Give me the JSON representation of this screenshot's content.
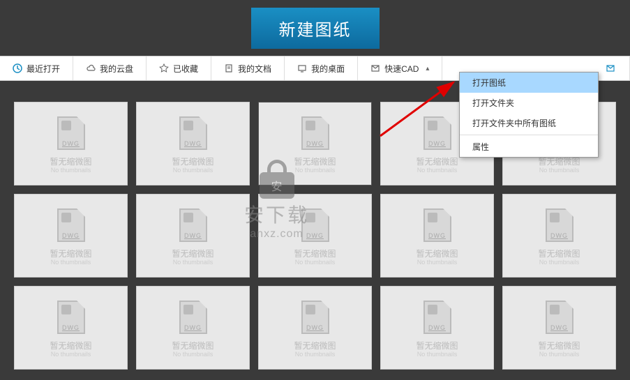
{
  "header": {
    "new_drawing": "新建图纸"
  },
  "tabs": {
    "recent": "最近打开",
    "cloud": "我的云盘",
    "favorites": "已收藏",
    "documents": "我的文档",
    "desktop": "我的桌面",
    "quickcad": "快速CAD"
  },
  "menu": {
    "open_drawing": "打开图纸",
    "open_folder": "打开文件夹",
    "open_all_in_folder": "打开文件夹中所有图纸",
    "properties": "属性"
  },
  "thumb": {
    "format": "DWG",
    "caption": "暂无缩微图",
    "subcaption": "No thumbnails"
  },
  "watermark": {
    "lock_char": "安",
    "brand": "安下载",
    "url": "anxz.com"
  }
}
